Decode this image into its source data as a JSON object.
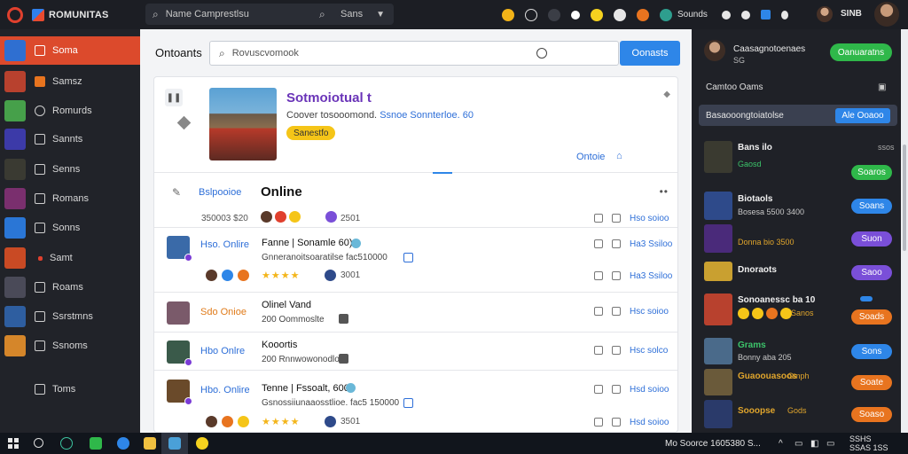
{
  "app": {
    "title": "ROMUNITAS"
  },
  "top_search": {
    "placeholder": "Name Camprestlsu",
    "filter_label": "Sans"
  },
  "top_status": "Sounds",
  "top_user": "SINB",
  "sidebar": {
    "items": [
      {
        "label": "Soma",
        "active": true,
        "thumb_color": "#2f6fd1"
      },
      {
        "label": "Samsz",
        "active": false,
        "thumb_color": "#b8412e"
      },
      {
        "label": "Romurds",
        "active": false,
        "thumb_color": "#46a04a"
      },
      {
        "label": "Sannts",
        "active": false,
        "thumb_color": "#3c3aa8"
      },
      {
        "label": "Senns",
        "active": false,
        "thumb_color": "#3a3a32"
      },
      {
        "label": "Romans",
        "active": false,
        "thumb_color": "#7a2f6e"
      },
      {
        "label": "Sonns",
        "active": false,
        "thumb_color": "#2a76d6"
      },
      {
        "label": "Samt",
        "active": false,
        "thumb_color": "#c94a24"
      },
      {
        "label": "Roams",
        "active": false,
        "thumb_color": "#4a4a58"
      },
      {
        "label": "Ssrstmns",
        "active": false,
        "thumb_color": "#2e5ea0"
      },
      {
        "label": "Ssnoms",
        "active": false,
        "thumb_color": "#d5862a"
      },
      {
        "label": "Toms",
        "active": false,
        "thumb_color": ""
      }
    ]
  },
  "main": {
    "title": "Ontoants",
    "search_placeholder": "Rovuscvomook",
    "search_button": "Oonasts",
    "game": {
      "title": "Sotmoiotual t",
      "meta_prefix": "Coover tosooomond.",
      "meta_link": "Ssnoe Sonnterloe. 60",
      "badge": "Sanestfo",
      "status_label": "Ontoie"
    },
    "section": {
      "label": "Bslpooioe",
      "title": "Online",
      "count": "350003 $20",
      "number": "2501",
      "action_label": "Hso soioo"
    },
    "rows": [
      {
        "status": "Hso. Onlire",
        "status_color": "#2e6fd8",
        "title": "Fanne | Sonamle 60)",
        "subtitle": "Gnneranoitsoaratilse fac510000",
        "number": "3001",
        "action": "Ha3 Ssiloo",
        "avatar_color": "#3a6aa8",
        "has_stars": true
      },
      {
        "status": "Sdo Onioe",
        "status_color": "#e07b1a",
        "title": "Olinel Vand",
        "subtitle": "200 Oommoslte",
        "number": "",
        "action": "Hsc soioo",
        "avatar_color": "#7a5a6a",
        "has_stars": false
      },
      {
        "status": "Hbo Onlre",
        "status_color": "#2e6fd8",
        "title": "Kooortis",
        "subtitle": "200 Rnnwowonodlo",
        "number": "",
        "action": "Hsc solco",
        "avatar_color": "#3a5a4a",
        "has_stars": false
      },
      {
        "status": "Hbo. Onlire",
        "status_color": "#2e6fd8",
        "title": "Tenne | Fssoalt, 600",
        "subtitle": "Gsnossiiunaaosstlioe. fac5 150000",
        "number": "3501",
        "action": "Hsd soioo",
        "avatar_color": "#6a4a2a",
        "has_stars": true
      }
    ]
  },
  "right": {
    "user_name": "Caasagnotoenaes",
    "user_sub": "SG",
    "user_button": "Oanuaratns",
    "section_title": "Camtoo Oams",
    "highlight_text": "Basaooongtoiatolse",
    "highlight_button": "Ale Ooaoo",
    "items": [
      {
        "title": "Bans ilo",
        "sub": "Gaosd",
        "sub_color": "#3cc46a",
        "button": "Soaros",
        "button_color": "#2fb84a",
        "thumb_color": "#3a3a30",
        "extra": "ssos"
      },
      {
        "title": "Biotaols",
        "sub": "Bosesa 5500 3400",
        "sub_color": "#c8c8c8",
        "button": "Soans",
        "button_color": "#2e86e8",
        "thumb_color": "#2e4a8a",
        "extra": ""
      },
      {
        "title": "",
        "sub": "Donna bio 3500",
        "sub_color": "#e0a52c",
        "button": "Suon",
        "button_color": "#7a4fd8",
        "thumb_color": "#4a2a7a",
        "extra": ""
      },
      {
        "title": "Dnoraots",
        "sub": "",
        "sub_color": "#c8c8c8",
        "button": "Saoo",
        "button_color": "#7a4fd8",
        "thumb_color": "#c9a030",
        "extra": ""
      },
      {
        "title": "Sonoanessc ba 10",
        "sub": "Sanos",
        "sub_color": "#e0a52c",
        "button": "Soads",
        "button_color": "#e8741f",
        "thumb_color": "#b8412e",
        "extra": ""
      },
      {
        "title": "Grams",
        "sub": "Bonny aba 205",
        "sub_color": "#c8c8c8",
        "button": "Sons",
        "button_color": "#2e86e8",
        "thumb_color": "#4a6a8a",
        "extra": ""
      },
      {
        "title": "Guaoouasoos",
        "sub": "Gmph",
        "sub_color": "#e0a52c",
        "button": "Soate",
        "button_color": "#e8741f",
        "thumb_color": "#6a5a3a",
        "extra": ""
      },
      {
        "title": "Sooopse",
        "sub": "Gods",
        "sub_color": "#e0a52c",
        "button": "Soaso",
        "button_color": "#e8741f",
        "thumb_color": "#2a3a6a",
        "extra": ""
      }
    ]
  },
  "taskbar": {
    "tray_text": "Mo Soorce 1605380 S...",
    "clock_line1": "SSHS",
    "clock_line2": "SSAS 1SS"
  }
}
